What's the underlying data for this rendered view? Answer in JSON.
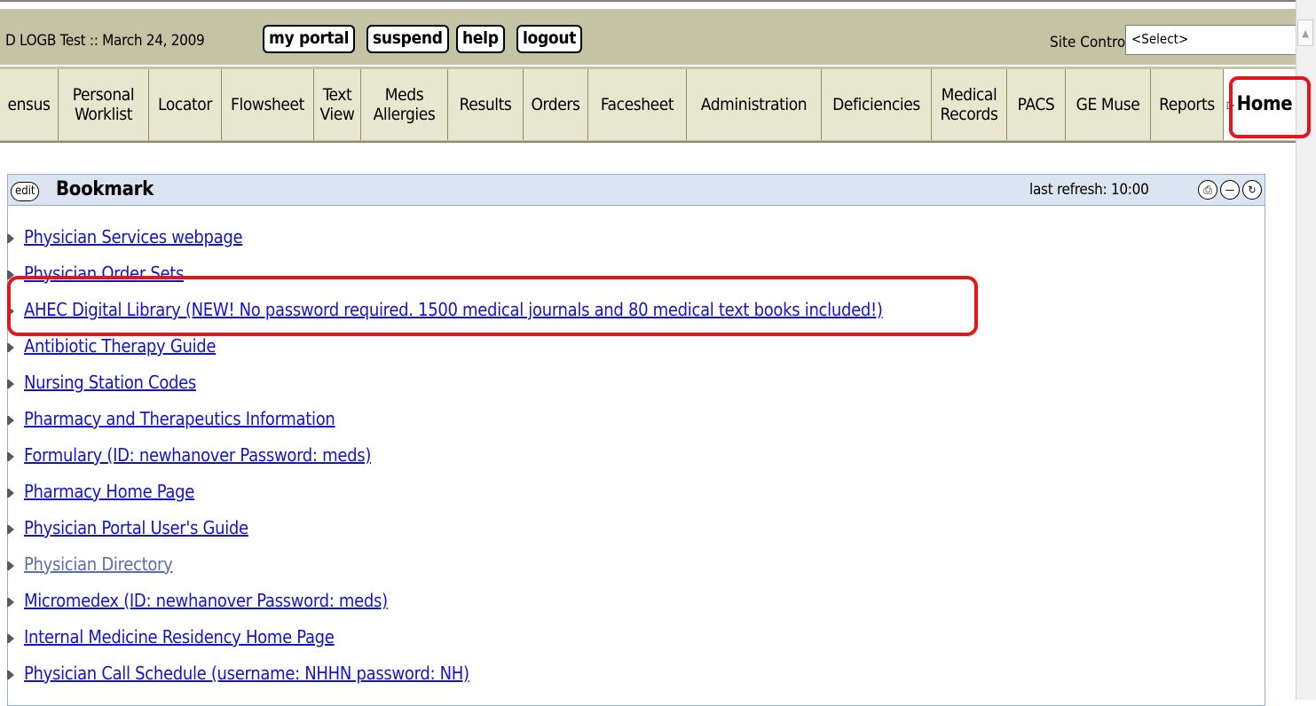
{
  "header": {
    "session_text": "D LOGB Test :: March 24, 2009",
    "buttons": [
      "my portal",
      "suspend",
      "help",
      "logout"
    ],
    "site_controls_label": "Site Controls:",
    "site_controls_value": "<Select>"
  },
  "nav": {
    "tabs": [
      {
        "label": "ensus"
      },
      {
        "label": "Personal\nWorklist"
      },
      {
        "label": "Locator"
      },
      {
        "label": "Flowsheet"
      },
      {
        "label": "Text\nView"
      },
      {
        "label": "Meds\nAllergies"
      },
      {
        "label": "Results"
      },
      {
        "label": "Orders"
      },
      {
        "label": "Facesheet"
      },
      {
        "label": "Administration"
      },
      {
        "label": "Deficiencies"
      },
      {
        "label": "Medical\nRecords"
      },
      {
        "label": "PACS"
      },
      {
        "label": "GE Muse"
      },
      {
        "label": "Reports"
      },
      {
        "label": "Home"
      }
    ],
    "active_tab": "Home"
  },
  "panel": {
    "edit_label": "edit",
    "title": "Bookmark",
    "refresh_text": "last refresh: 10:00",
    "icons": [
      "print-icon",
      "minimize-icon",
      "refresh-icon"
    ]
  },
  "bookmarks": [
    {
      "text": "Physician Services webpage"
    },
    {
      "text": "Physician Order Sets"
    },
    {
      "text": "AHEC Digital Library (NEW! No password required. 1500 medical journals and 80 medical text books included!)"
    },
    {
      "text": "Antibiotic Therapy Guide"
    },
    {
      "text": "Nursing Station Codes"
    },
    {
      "text": "Pharmacy and Therapeutics Information"
    },
    {
      "text": "Formulary (ID: newhanover Password: meds)"
    },
    {
      "text": "Pharmacy Home Page"
    },
    {
      "text": "Physician Portal User's Guide"
    },
    {
      "text": "Physician Directory",
      "visited": true
    },
    {
      "text": "Micromedex (ID: newhanover Password: meds)"
    },
    {
      "text": "Internal Medicine Residency Home Page"
    },
    {
      "text": "Physician Call Schedule (username: NHHN password: NH)"
    }
  ],
  "colors": {
    "bar": "#c4c3a3",
    "highlight": "#e8141b",
    "link": "#1414c8",
    "panel_header": "#dbe5f1"
  }
}
